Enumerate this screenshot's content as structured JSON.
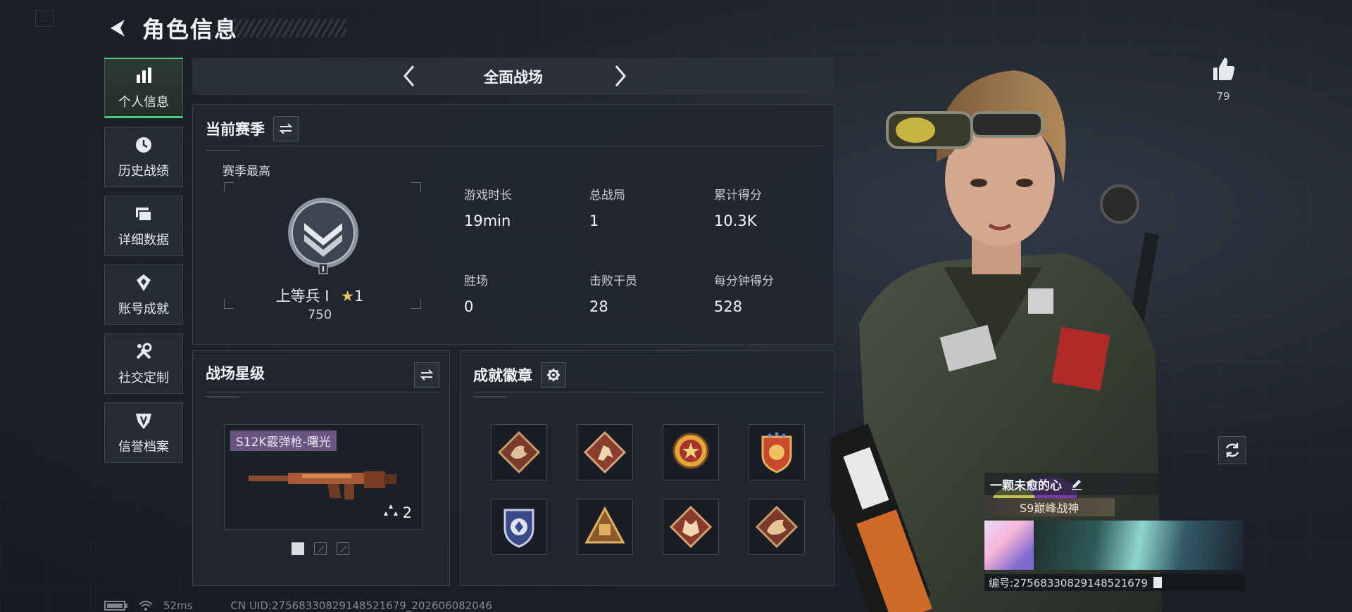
{
  "header": {
    "title": "角色信息"
  },
  "sidebar": {
    "items": [
      {
        "label": "个人信息",
        "icon": "bar-chart-icon",
        "active": true
      },
      {
        "label": "历史战绩",
        "icon": "clock-icon",
        "active": false
      },
      {
        "label": "详细数据",
        "icon": "folders-icon",
        "active": false
      },
      {
        "label": "账号成就",
        "icon": "medal-icon",
        "active": false
      },
      {
        "label": "社交定制",
        "icon": "wrench-icon",
        "active": false
      },
      {
        "label": "信誉档案",
        "icon": "shield-icon",
        "active": false
      }
    ]
  },
  "mode": {
    "title": "全面战场"
  },
  "season": {
    "title": "当前赛季",
    "best_label": "赛季最高",
    "rank_name": "上等兵 I",
    "rank_stars": "1",
    "rank_score": "750",
    "stats": [
      {
        "label": "游戏时长",
        "value": "19min"
      },
      {
        "label": "总战局",
        "value": "1"
      },
      {
        "label": "累计得分",
        "value": "10.3K"
      },
      {
        "label": "胜场",
        "value": "0"
      },
      {
        "label": "击败干员",
        "value": "28"
      },
      {
        "label": "每分钟得分",
        "value": "528"
      }
    ]
  },
  "star": {
    "title": "战场星级",
    "weapon_name": "S12K霰弹枪-曙光",
    "weapon_tier": "2",
    "pages": 3,
    "active_page": 0
  },
  "badges": {
    "title": "成就徽章",
    "items": [
      "dragon-badge",
      "soldier-badge",
      "star-medal-badge",
      "crest-badge",
      "shield-badge",
      "pyramid-badge",
      "wolf-badge",
      "dragon-badge-2"
    ]
  },
  "like": {
    "count": "79"
  },
  "profile": {
    "nickname": "一颗未愈的心",
    "title_chip": "S9巅峰战神",
    "uid": "编号:27568330829148521679"
  },
  "status": {
    "ping": "52ms",
    "uid_line": "CN UID:27568330829148521679_202606082046"
  },
  "colors": {
    "accent": "#3fcf7f",
    "panel": "#22272f",
    "weapon_chip": "#6a5580"
  }
}
